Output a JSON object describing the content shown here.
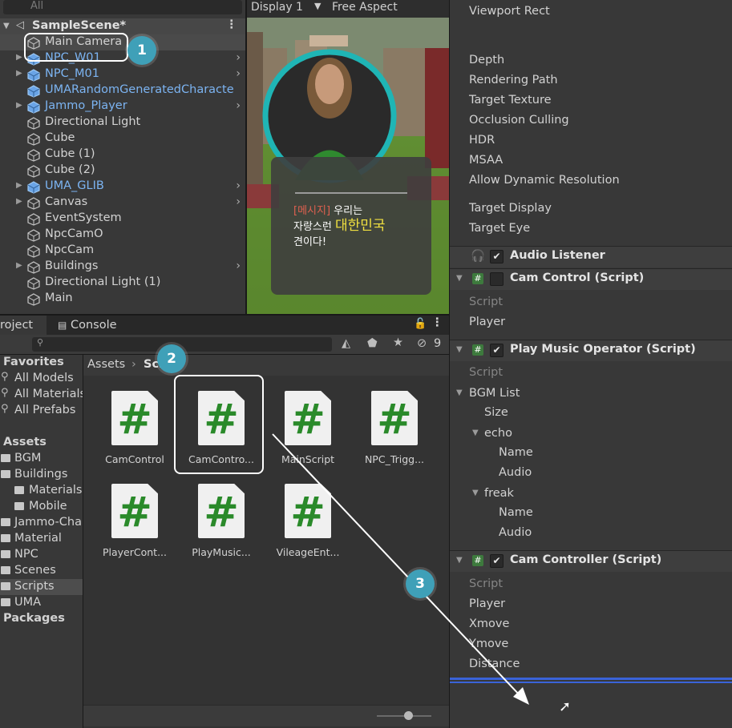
{
  "hierarchy": {
    "search_placeholder": "All",
    "scene_name": "SampleScene*",
    "items": [
      {
        "label": "Main Camera",
        "prefab": false,
        "expandable": false
      },
      {
        "label": "NPC_W01",
        "prefab": true,
        "expandable": true
      },
      {
        "label": "NPC_M01",
        "prefab": true,
        "expandable": true
      },
      {
        "label": "UMARandomGeneratedCharacte",
        "prefab": true,
        "expandable": false
      },
      {
        "label": "Jammo_Player",
        "prefab": true,
        "expandable": true
      },
      {
        "label": "Directional Light",
        "prefab": false,
        "expandable": false
      },
      {
        "label": "Cube",
        "prefab": false,
        "expandable": false
      },
      {
        "label": "Cube (1)",
        "prefab": false,
        "expandable": false
      },
      {
        "label": "Cube (2)",
        "prefab": false,
        "expandable": false
      },
      {
        "label": "UMA_GLIB",
        "prefab": true,
        "expandable": true
      },
      {
        "label": "Canvas",
        "prefab": false,
        "expandable": true
      },
      {
        "label": "EventSystem",
        "prefab": false,
        "expandable": false
      },
      {
        "label": "NpcCamO",
        "prefab": false,
        "expandable": false
      },
      {
        "label": "NpcCam",
        "prefab": false,
        "expandable": false
      },
      {
        "label": "Buildings",
        "prefab": false,
        "expandable": true
      },
      {
        "label": "Directional Light (1)",
        "prefab": false,
        "expandable": false
      },
      {
        "label": "Main",
        "prefab": false,
        "expandable": false
      }
    ]
  },
  "game_view": {
    "display": "Display 1",
    "aspect": "Free Aspect",
    "dialog_tag": "[메시지]",
    "dialog_text_1": "우리는",
    "dialog_text_2": "자랑스런",
    "dialog_highlight": "대한민국",
    "dialog_text_3": "견이다!"
  },
  "project": {
    "tab_project": "roject",
    "tab_console": "Console",
    "hidden_count": "9",
    "breadcrumb_root": "Assets",
    "breadcrumb_current": "Scr",
    "sidebar": [
      {
        "label": "Favorites",
        "kind": "header"
      },
      {
        "label": "All Models",
        "kind": "search"
      },
      {
        "label": "All Materials",
        "kind": "search"
      },
      {
        "label": "All Prefabs",
        "kind": "search"
      },
      {
        "label": "",
        "kind": "spacer"
      },
      {
        "label": "Assets",
        "kind": "header"
      },
      {
        "label": "BGM",
        "kind": "folder"
      },
      {
        "label": "Buildings",
        "kind": "folder-open"
      },
      {
        "label": "Materials",
        "kind": "subfolder"
      },
      {
        "label": "Mobile",
        "kind": "subfolder"
      },
      {
        "label": "Jammo-Cha",
        "kind": "folder"
      },
      {
        "label": "Material",
        "kind": "folder"
      },
      {
        "label": "NPC",
        "kind": "folder"
      },
      {
        "label": "Scenes",
        "kind": "folder"
      },
      {
        "label": "Scripts",
        "kind": "folder",
        "selected": true
      },
      {
        "label": "UMA",
        "kind": "folder"
      },
      {
        "label": "Packages",
        "kind": "header"
      }
    ],
    "assets": [
      "CamControl",
      "CamContro...",
      "MainScript",
      "NPC_Trigg...",
      "PlayerCont...",
      "PlayMusic...",
      "VileageEnt..."
    ]
  },
  "inspector": {
    "top_props": [
      "Viewport Rect",
      "Depth",
      "Rendering Path",
      "Target Texture",
      "Occlusion Culling",
      "HDR",
      "MSAA",
      "Allow Dynamic Resolution",
      "Target Display",
      "Target Eye"
    ],
    "audio_listener": "Audio Listener",
    "cam_control": {
      "title": "Cam Control (Script)",
      "script": "Script",
      "player": "Player"
    },
    "play_music": {
      "title": "Play Music Operator (Script)",
      "script": "Script",
      "bgm_list": "BGM List",
      "size": "Size",
      "echo": "echo",
      "freak": "freak",
      "name": "Name",
      "audio": "Audio"
    },
    "cam_controller": {
      "title": "Cam Controller (Script)",
      "script": "Script",
      "player": "Player",
      "xmove": "Xmove",
      "ymove": "Ymove",
      "distance": "Distance"
    }
  },
  "callouts": [
    "1",
    "2",
    "3"
  ]
}
